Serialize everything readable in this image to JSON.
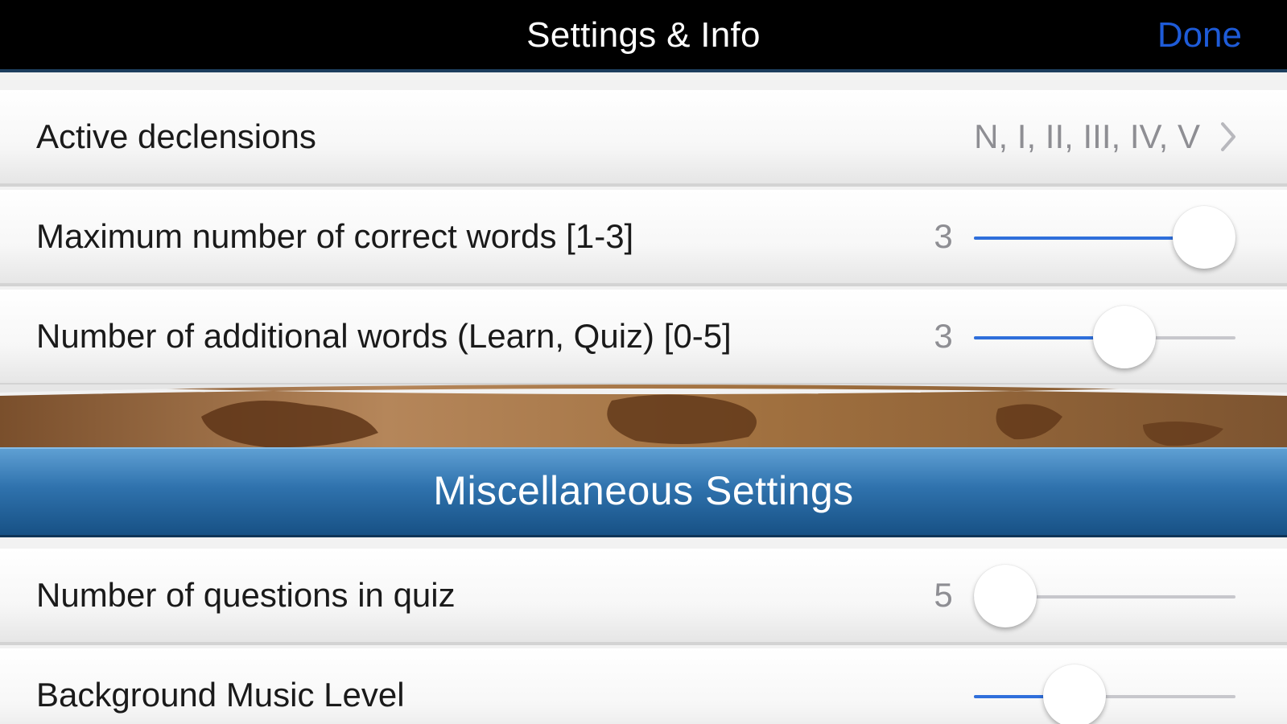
{
  "nav": {
    "title": "Settings & Info",
    "done_label": "Done"
  },
  "rows": {
    "declensions": {
      "label": "Active declensions",
      "detail": "N, I, II, III, IV, V"
    },
    "max_correct": {
      "label": "Maximum number of correct words [1-3]",
      "value": "3",
      "fraction": 1.0
    },
    "additional_words": {
      "label": "Number of additional words (Learn, Quiz) [0-5]",
      "value": "3",
      "fraction": 0.6
    }
  },
  "section": {
    "title": "Miscellaneous Settings"
  },
  "misc_rows": {
    "questions": {
      "label": "Number of questions in quiz",
      "value": "5",
      "fraction": 0.0
    },
    "music": {
      "label": "Background Music Level",
      "fraction": 0.35
    }
  },
  "colors": {
    "accent": "#1e5bd8",
    "slider_fill": "#2f6fdb",
    "section_header": "#2f72ad"
  },
  "icons": {
    "chevron": "chevron-right-icon"
  }
}
